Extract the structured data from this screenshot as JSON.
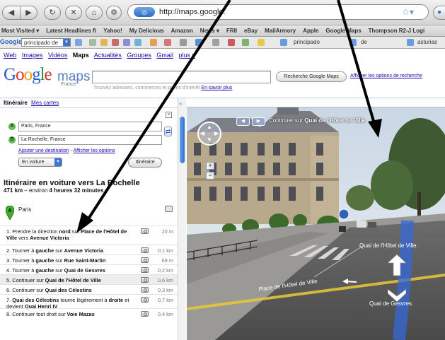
{
  "browser": {
    "url": "http://maps.google.",
    "nav_icons": [
      "back-icon",
      "forward-icon",
      "reload-icon",
      "stop-icon",
      "home-icon"
    ],
    "bookmarks": [
      "Most Visited ▾",
      "Latest Headlines ℏ",
      "Yahoo!",
      "My Delicious",
      "Amazon",
      "News ▾",
      "FRII",
      "eBay",
      "MailArmory",
      "Apple",
      "Google Maps",
      "Thompson R2-J Logi"
    ],
    "toolbar": {
      "logo": "Google",
      "search_value": "principado de",
      "text1": "principado",
      "text2": "de",
      "text3": "asturias"
    }
  },
  "google": {
    "nav_links": [
      "Web",
      "Images",
      "Vidéos",
      "Maps",
      "Actualités",
      "Groupes",
      "Gmail",
      "plus ▾"
    ],
    "active_link": "Maps",
    "logo_letters": [
      "G",
      "o",
      "o",
      "g",
      "l",
      "e"
    ],
    "logo_product": "maps",
    "logo_country": "France",
    "search_button": "Recherche Google Maps",
    "search_options": "Afficher les options de recherche",
    "search_hint": "Trouvez adresses, commerces et points d'intérêt",
    "search_hint_link": "En savoir plus"
  },
  "panel": {
    "tab_active": "Itinéraire",
    "tab_other": "Mes cartes",
    "close": "×",
    "waypoints": [
      {
        "marker": "A",
        "value": "Paris, France"
      },
      {
        "marker": "B",
        "value": "La Rochelle, France"
      }
    ],
    "add_destination": "Ajouter une destination",
    "sep": "-",
    "show_options": "Afficher les options",
    "mode": "En voiture",
    "route_button": "Itinéraire",
    "route_title": "Itinéraire en voiture vers La Rochelle",
    "route_distance": "471 km",
    "route_duration_prefix": "– environ",
    "route_duration": "4 heures 32 minutes",
    "start_label": "Paris",
    "steps": [
      {
        "n": "1.",
        "pre": "Prendre la direction ",
        "b1": "nord",
        "mid": " sur ",
        "b2": "Place de l'Hôtel de Ville",
        "mid2": " vers ",
        "b3": "Avenue Victoria",
        "dist": "20 m"
      },
      {
        "n": "2.",
        "pre": "Tourner à ",
        "b1": "gauche",
        "mid": " sur ",
        "b2": "Avenue Victoria",
        "mid2": "",
        "b3": "",
        "dist": "0,1 km"
      },
      {
        "n": "3.",
        "pre": "Tourner à ",
        "b1": "gauche",
        "mid": " sur ",
        "b2": "Rue Saint-Martin",
        "mid2": "",
        "b3": "",
        "dist": "69 m"
      },
      {
        "n": "4.",
        "pre": "Tourner à ",
        "b1": "gauche",
        "mid": " sur ",
        "b2": "Quai de Gesvres",
        "mid2": "",
        "b3": "",
        "dist": "0,2 km"
      },
      {
        "n": "5.",
        "pre": "Continuer sur ",
        "b1": "Quai de l'Hôtel de Ville",
        "mid": "",
        "b2": "",
        "mid2": "",
        "b3": "",
        "dist": "0,6 km"
      },
      {
        "n": "6.",
        "pre": "Continuer sur ",
        "b1": "Quai des Célestins",
        "mid": "",
        "b2": "",
        "mid2": "",
        "b3": "",
        "dist": "0,3 km"
      },
      {
        "n": "7.",
        "pre": "",
        "b1": "Quai des Célestins",
        "mid": " tourne légèrement à ",
        "b2": "droite",
        "mid2": " et devient ",
        "b3": "Quai Henri IV",
        "dist": "0,7 km"
      },
      {
        "n": "8.",
        "pre": "Continuer tout droit sur ",
        "b1": "Voie Mazas",
        "mid": "",
        "b2": "",
        "mid2": "",
        "b3": "",
        "dist": "0,4 km"
      }
    ],
    "highlighted_step": 4,
    "collapse": "«"
  },
  "streetview": {
    "caption_prefix": "Continuer sur ",
    "caption_bold": "Quai de l'Hôtel de Ville",
    "prev": "◀",
    "next": "▶",
    "zoom_in": "+",
    "zoom_out": "−",
    "road_labels": [
      "Quai de l'Hôtel de Ville",
      "Quai de Gesvres",
      "Place de l'Hôtel de Ville"
    ]
  }
}
